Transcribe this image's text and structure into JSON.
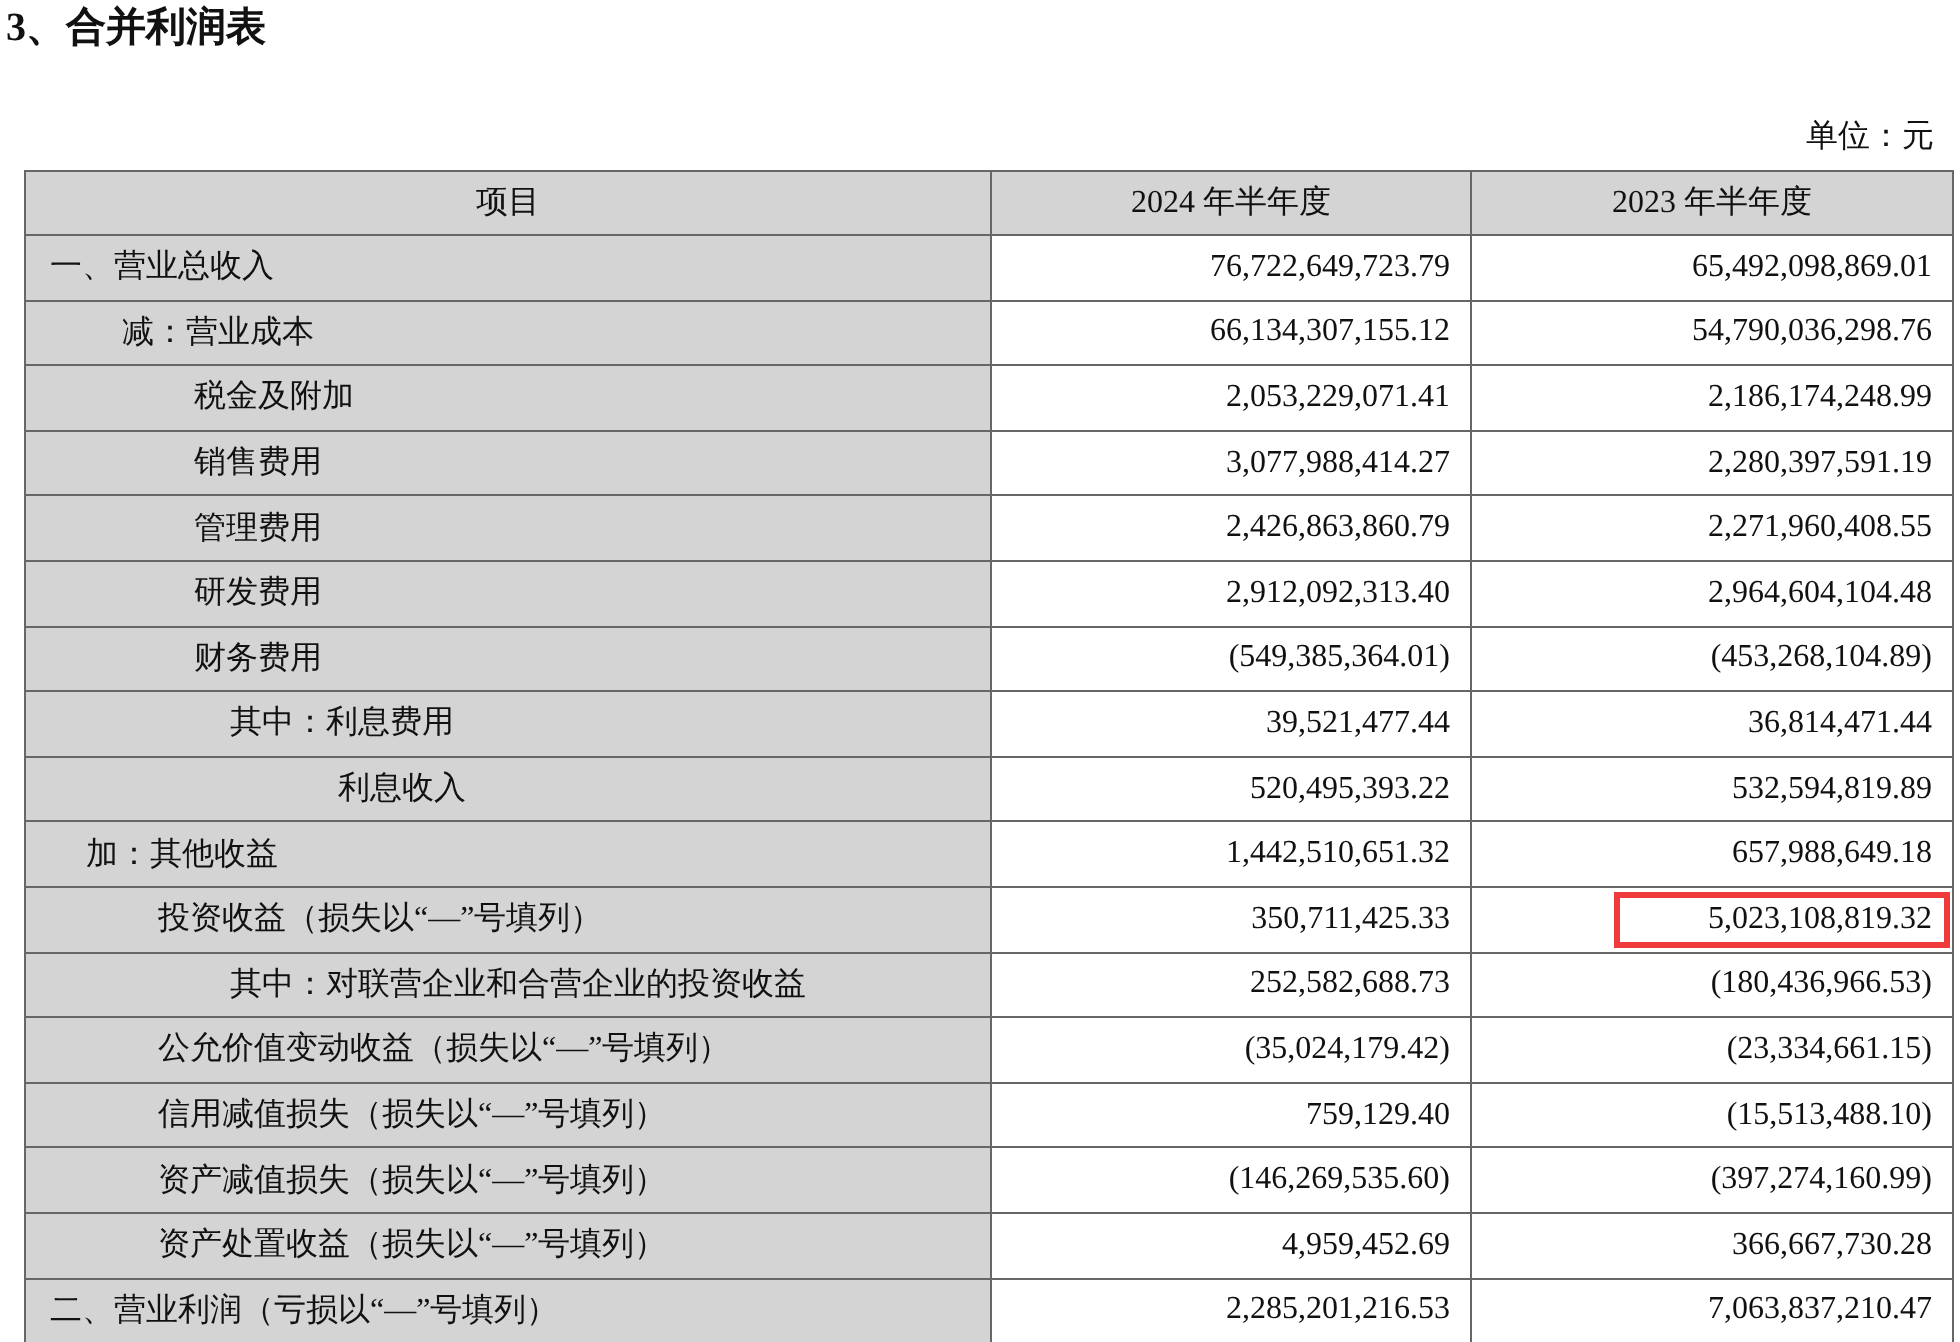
{
  "title": "3、合并利润表",
  "unit": "单位：元",
  "table": {
    "columns": [
      "项目",
      "2024 年半年度",
      "2023 年半年度"
    ],
    "rows": [
      {
        "kind": "section",
        "item": "一、营业总收入",
        "y2024": "76,722,649,723.79",
        "y2023": "65,492,098,869.01",
        "highlighted": false
      },
      {
        "kind": "less",
        "item": "减：营业成本",
        "y2024": "66,134,307,155.12",
        "y2023": "54,790,036,298.76",
        "highlighted": false
      },
      {
        "kind": "less-item",
        "item": "税金及附加",
        "y2024": "2,053,229,071.41",
        "y2023": "2,186,174,248.99",
        "highlighted": false
      },
      {
        "kind": "less-item",
        "item": "销售费用",
        "y2024": "3,077,988,414.27",
        "y2023": "2,280,397,591.19",
        "highlighted": false
      },
      {
        "kind": "less-item",
        "item": "管理费用",
        "y2024": "2,426,863,860.79",
        "y2023": "2,271,960,408.55",
        "highlighted": false
      },
      {
        "kind": "less-item",
        "item": "研发费用",
        "y2024": "2,912,092,313.40",
        "y2023": "2,964,604,104.48",
        "highlighted": false
      },
      {
        "kind": "less-item",
        "item": "财务费用",
        "y2024": "(549,385,364.01)",
        "y2023": "(453,268,104.89)",
        "highlighted": false
      },
      {
        "kind": "of-which",
        "item": "其中：利息费用",
        "y2024": "39,521,477.44",
        "y2023": "36,814,471.44",
        "highlighted": false
      },
      {
        "kind": "of-which-cont",
        "item": "利息收入",
        "y2024": "520,495,393.22",
        "y2023": "532,594,819.89",
        "highlighted": false
      },
      {
        "kind": "add",
        "item": "加：其他收益",
        "y2024": "1,442,510,651.32",
        "y2023": "657,988,649.18",
        "highlighted": false
      },
      {
        "kind": "add-item",
        "item": "投资收益（损失以“—”号填列）",
        "y2024": "350,711,425.33",
        "y2023": "5,023,108,819.32",
        "highlighted": true
      },
      {
        "kind": "of-which",
        "item": "其中：对联营企业和合营企业的投资收益",
        "y2024": "252,582,688.73",
        "y2023": "(180,436,966.53)",
        "highlighted": false
      },
      {
        "kind": "add-item",
        "item": "公允价值变动收益（损失以“—”号填列）",
        "y2024": "(35,024,179.42)",
        "y2023": "(23,334,661.15)",
        "highlighted": false
      },
      {
        "kind": "add-item",
        "item": "信用减值损失（损失以“—”号填列）",
        "y2024": "759,129.40",
        "y2023": "(15,513,488.10)",
        "highlighted": false
      },
      {
        "kind": "add-item",
        "item": "资产减值损失（损失以“—”号填列）",
        "y2024": "(146,269,535.60)",
        "y2023": "(397,274,160.99)",
        "highlighted": false
      },
      {
        "kind": "add-item",
        "item": "资产处置收益（损失以“—”号填列）",
        "y2024": "4,959,452.69",
        "y2023": "366,667,730.28",
        "highlighted": false
      },
      {
        "kind": "section",
        "item": "二、营业利润（亏损以“—”号填列）",
        "y2024": "2,285,201,216.53",
        "y2023": "7,063,837,210.47",
        "highlighted": false
      }
    ]
  }
}
